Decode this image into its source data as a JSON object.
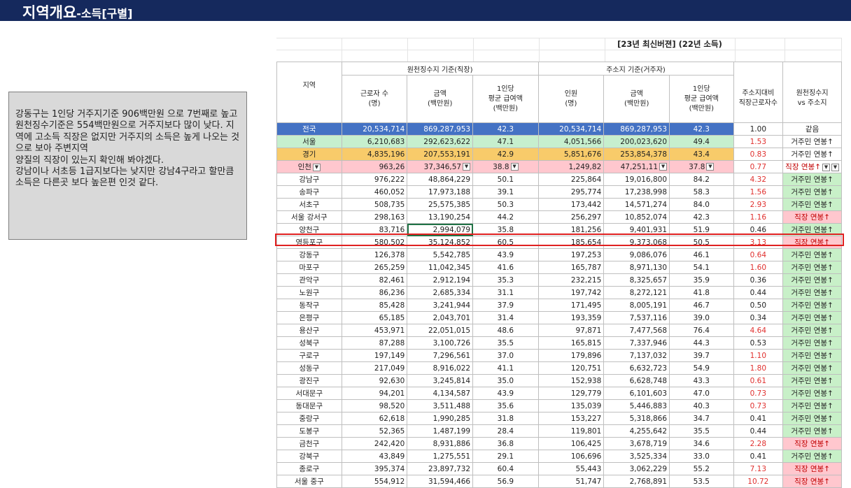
{
  "header": {
    "title_main": "지역개요",
    "title_sub": "-소득[구별]"
  },
  "note": {
    "lines": [
      " 강동구는 1인당 거주지기준 906백만원 으로 7번째로 높고 원천징수기준은 554백만원으로 거주지보다 많이 낮다. 지역에 고소득 직장은 없지만 거주지의 소득은 높게 나오는 것으로 보아 주변지역",
      "양질의 직장이 있는지 확인해 봐야겠다.",
      "강남이나 서초등 1급지보다는 낮지만 강남4구라고 할만큼 소득은 다른곳 보다 높은편 인것 같다."
    ]
  },
  "sheet": {
    "subtitle": "[23년 최신버젼] (22년 소득)",
    "headers": {
      "region": "지역",
      "withholding_group": "원천징수지 기준(직장)",
      "residence_group": "주소지 기준(거주자)",
      "workers": "근로자 수\n(명)",
      "amount": "금액\n(백만원)",
      "per_capita": "1인당\n평균 급여액\n(백만원)",
      "persons": "인원\n(명)",
      "amount2": "금액\n(백만원)",
      "per_capita2": "1인당\n평균 급여액\n(백만원)",
      "ratio": "주소지대비\n직장근로자수",
      "compare": "원천징수지\nvs 주소지"
    },
    "rows": [
      {
        "region": "전국",
        "w": "20,534,714",
        "a": "869,287,953",
        "p": "42.3",
        "r": "20,534,714",
        "ra": "869,287,953",
        "rp": "42.3",
        "ratio": "1.00",
        "vs": "같음",
        "kind": "same",
        "ratio_red": false
      },
      {
        "region": "서울",
        "w": "6,210,683",
        "a": "292,623,622",
        "p": "47.1",
        "r": "4,051,566",
        "ra": "200,023,620",
        "rp": "49.4",
        "ratio": "1.53",
        "vs": "거주민 연봉↑",
        "kind": "res",
        "ratio_red": true
      },
      {
        "region": "경기",
        "w": "4,835,196",
        "a": "207,553,191",
        "p": "42.9",
        "r": "5,851,676",
        "ra": "253,854,378",
        "rp": "43.4",
        "ratio": "0.83",
        "vs": "거주민 연봉↑",
        "kind": "res",
        "ratio_red": true
      },
      {
        "region": "인천",
        "w": "963,26",
        "a": "37,346,57",
        "p": "38.8",
        "r": "1,249,82",
        "ra": "47,251,11",
        "rp": "37.8",
        "ratio": "0.77",
        "vs": "직장 연봉↑",
        "kind": "job",
        "ratio_red": true
      },
      {
        "region": "강남구",
        "w": "976,222",
        "a": "48,864,229",
        "p": "50.1",
        "r": "225,864",
        "ra": "19,016,800",
        "rp": "84.2",
        "ratio": "4.32",
        "vs": "거주민 연봉↑",
        "kind": "res",
        "ratio_red": true
      },
      {
        "region": "송파구",
        "w": "460,052",
        "a": "17,973,188",
        "p": "39.1",
        "r": "295,774",
        "ra": "17,238,998",
        "rp": "58.3",
        "ratio": "1.56",
        "vs": "거주민 연봉↑",
        "kind": "res",
        "ratio_red": true
      },
      {
        "region": "서초구",
        "w": "508,735",
        "a": "25,575,385",
        "p": "50.3",
        "r": "173,442",
        "ra": "14,571,274",
        "rp": "84.0",
        "ratio": "2.93",
        "vs": "거주민 연봉↑",
        "kind": "res",
        "ratio_red": true
      },
      {
        "region": "서울 강서구",
        "w": "298,163",
        "a": "13,190,254",
        "p": "44.2",
        "r": "256,297",
        "ra": "10,852,074",
        "rp": "42.3",
        "ratio": "1.16",
        "vs": "직장 연봉↑",
        "kind": "job",
        "ratio_red": true
      },
      {
        "region": "양천구",
        "w": "83,716",
        "a": "2,994,079",
        "p": "35.8",
        "r": "181,256",
        "ra": "9,401,931",
        "rp": "51.9",
        "ratio": "0.46",
        "vs": "거주민 연봉↑",
        "kind": "res",
        "ratio_red": false
      },
      {
        "region": "영등포구",
        "w": "580,502",
        "a": "35,124,852",
        "p": "60.5",
        "r": "185,654",
        "ra": "9,373,068",
        "rp": "50.5",
        "ratio": "3.13",
        "vs": "직장 연봉↑",
        "kind": "job",
        "ratio_red": true
      },
      {
        "region": "강동구",
        "w": "126,378",
        "a": "5,542,785",
        "p": "43.9",
        "r": "197,253",
        "ra": "9,086,076",
        "rp": "46.1",
        "ratio": "0.64",
        "vs": "거주민 연봉↑",
        "kind": "res",
        "ratio_red": true
      },
      {
        "region": "마포구",
        "w": "265,259",
        "a": "11,042,345",
        "p": "41.6",
        "r": "165,787",
        "ra": "8,971,130",
        "rp": "54.1",
        "ratio": "1.60",
        "vs": "거주민 연봉↑",
        "kind": "res",
        "ratio_red": true
      },
      {
        "region": "관악구",
        "w": "82,461",
        "a": "2,912,194",
        "p": "35.3",
        "r": "232,215",
        "ra": "8,325,657",
        "rp": "35.9",
        "ratio": "0.36",
        "vs": "거주민 연봉↑",
        "kind": "res",
        "ratio_red": false
      },
      {
        "region": "노원구",
        "w": "86,236",
        "a": "2,685,334",
        "p": "31.1",
        "r": "197,742",
        "ra": "8,272,121",
        "rp": "41.8",
        "ratio": "0.44",
        "vs": "거주민 연봉↑",
        "kind": "res",
        "ratio_red": false
      },
      {
        "region": "동작구",
        "w": "85,428",
        "a": "3,241,944",
        "p": "37.9",
        "r": "171,495",
        "ra": "8,005,191",
        "rp": "46.7",
        "ratio": "0.50",
        "vs": "거주민 연봉↑",
        "kind": "res",
        "ratio_red": false
      },
      {
        "region": "은평구",
        "w": "65,185",
        "a": "2,043,701",
        "p": "31.4",
        "r": "193,359",
        "ra": "7,537,116",
        "rp": "39.0",
        "ratio": "0.34",
        "vs": "거주민 연봉↑",
        "kind": "res",
        "ratio_red": false
      },
      {
        "region": "용산구",
        "w": "453,971",
        "a": "22,051,015",
        "p": "48.6",
        "r": "97,871",
        "ra": "7,477,568",
        "rp": "76.4",
        "ratio": "4.64",
        "vs": "거주민 연봉↑",
        "kind": "res",
        "ratio_red": true
      },
      {
        "region": "성북구",
        "w": "87,288",
        "a": "3,100,726",
        "p": "35.5",
        "r": "165,815",
        "ra": "7,337,946",
        "rp": "44.3",
        "ratio": "0.53",
        "vs": "거주민 연봉↑",
        "kind": "res",
        "ratio_red": false
      },
      {
        "region": "구로구",
        "w": "197,149",
        "a": "7,296,561",
        "p": "37.0",
        "r": "179,896",
        "ra": "7,137,032",
        "rp": "39.7",
        "ratio": "1.10",
        "vs": "거주민 연봉↑",
        "kind": "res",
        "ratio_red": true
      },
      {
        "region": "성동구",
        "w": "217,049",
        "a": "8,916,022",
        "p": "41.1",
        "r": "120,751",
        "ra": "6,632,723",
        "rp": "54.9",
        "ratio": "1.80",
        "vs": "거주민 연봉↑",
        "kind": "res",
        "ratio_red": true
      },
      {
        "region": "광진구",
        "w": "92,630",
        "a": "3,245,814",
        "p": "35.0",
        "r": "152,938",
        "ra": "6,628,748",
        "rp": "43.3",
        "ratio": "0.61",
        "vs": "거주민 연봉↑",
        "kind": "res",
        "ratio_red": true
      },
      {
        "region": "서대문구",
        "w": "94,201",
        "a": "4,134,587",
        "p": "43.9",
        "r": "129,779",
        "ra": "6,101,603",
        "rp": "47.0",
        "ratio": "0.73",
        "vs": "거주민 연봉↑",
        "kind": "res",
        "ratio_red": true
      },
      {
        "region": "동대문구",
        "w": "98,520",
        "a": "3,511,488",
        "p": "35.6",
        "r": "135,039",
        "ra": "5,446,883",
        "rp": "40.3",
        "ratio": "0.73",
        "vs": "거주민 연봉↑",
        "kind": "res",
        "ratio_red": true
      },
      {
        "region": "중랑구",
        "w": "62,618",
        "a": "1,990,285",
        "p": "31.8",
        "r": "153,227",
        "ra": "5,318,866",
        "rp": "34.7",
        "ratio": "0.41",
        "vs": "거주민 연봉↑",
        "kind": "res",
        "ratio_red": false
      },
      {
        "region": "도봉구",
        "w": "52,365",
        "a": "1,487,199",
        "p": "28.4",
        "r": "119,801",
        "ra": "4,255,642",
        "rp": "35.5",
        "ratio": "0.44",
        "vs": "거주민 연봉↑",
        "kind": "res",
        "ratio_red": false
      },
      {
        "region": "금천구",
        "w": "242,420",
        "a": "8,931,886",
        "p": "36.8",
        "r": "106,425",
        "ra": "3,678,719",
        "rp": "34.6",
        "ratio": "2.28",
        "vs": "직장 연봉↑",
        "kind": "job",
        "ratio_red": true
      },
      {
        "region": "강북구",
        "w": "43,849",
        "a": "1,275,551",
        "p": "29.1",
        "r": "106,696",
        "ra": "3,525,334",
        "rp": "33.0",
        "ratio": "0.41",
        "vs": "거주민 연봉↑",
        "kind": "res",
        "ratio_red": false
      },
      {
        "region": "종로구",
        "w": "395,374",
        "a": "23,897,732",
        "p": "60.4",
        "r": "55,443",
        "ra": "3,062,229",
        "rp": "55.2",
        "ratio": "7.13",
        "vs": "직장 연봉↑",
        "kind": "job",
        "ratio_red": true
      },
      {
        "region": "서울 중구",
        "w": "554,912",
        "a": "31,594,466",
        "p": "56.9",
        "r": "51,747",
        "ra": "2,768,891",
        "rp": "53.5",
        "ratio": "10.72",
        "vs": "직장 연봉↑",
        "kind": "job",
        "ratio_red": true
      }
    ],
    "colors": {
      "national": "#4472c4",
      "seoul": "#c6efce",
      "gyeonggi": "#f8cb6a",
      "incheon": "#ffc7ce",
      "highlight_box": "#e02020",
      "title_bg": "#15295d"
    }
  }
}
